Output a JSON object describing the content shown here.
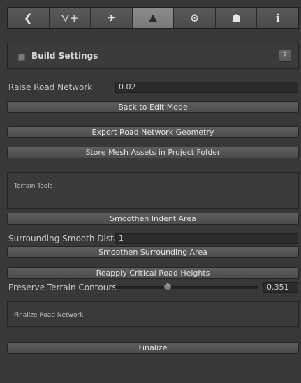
{
  "toolbar": {
    "tabs": [
      {
        "icon": "back-arrow-icon",
        "glyph": "❮",
        "active": false
      },
      {
        "icon": "add-road-icon",
        "glyph": "⛛+",
        "active": false
      },
      {
        "icon": "intersection-icon",
        "glyph": "✈",
        "active": false
      },
      {
        "icon": "terrain-build-icon",
        "glyph": "⛰",
        "active": true
      },
      {
        "icon": "gear-icon",
        "glyph": "⚙",
        "active": false
      },
      {
        "icon": "stamp-icon",
        "glyph": "☗",
        "active": false
      },
      {
        "icon": "info-icon",
        "glyph": "ℹ",
        "active": false
      }
    ]
  },
  "build_settings": {
    "title": "Build Settings",
    "help_label": "?"
  },
  "raise_road_network": {
    "label": "Raise Road Network",
    "value": "0.02"
  },
  "buttons": {
    "back_to_edit": "Back to Edit Mode",
    "export_geometry": "Export Road Network Geometry",
    "store_mesh": "Store Mesh Assets in Project Folder",
    "smoothen_indent": "Smoothen Indent Area",
    "smoothen_surrounding": "Smoothen Surrounding Area",
    "reapply_heights": "Reapply Critical Road Heights",
    "finalize": "Finalize"
  },
  "terrain_tools": {
    "title": "Terrain Tools"
  },
  "surrounding_smooth": {
    "label": "Surrounding Smooth Distai",
    "value": "1"
  },
  "preserve_contours": {
    "label": "Preserve Terrain Contours",
    "value": "0.351",
    "fraction": 0.351
  },
  "finalize_section": {
    "title": "Finalize Road Network"
  },
  "colors": {
    "background": "#383838",
    "active_tab": "#8c8c8c"
  }
}
